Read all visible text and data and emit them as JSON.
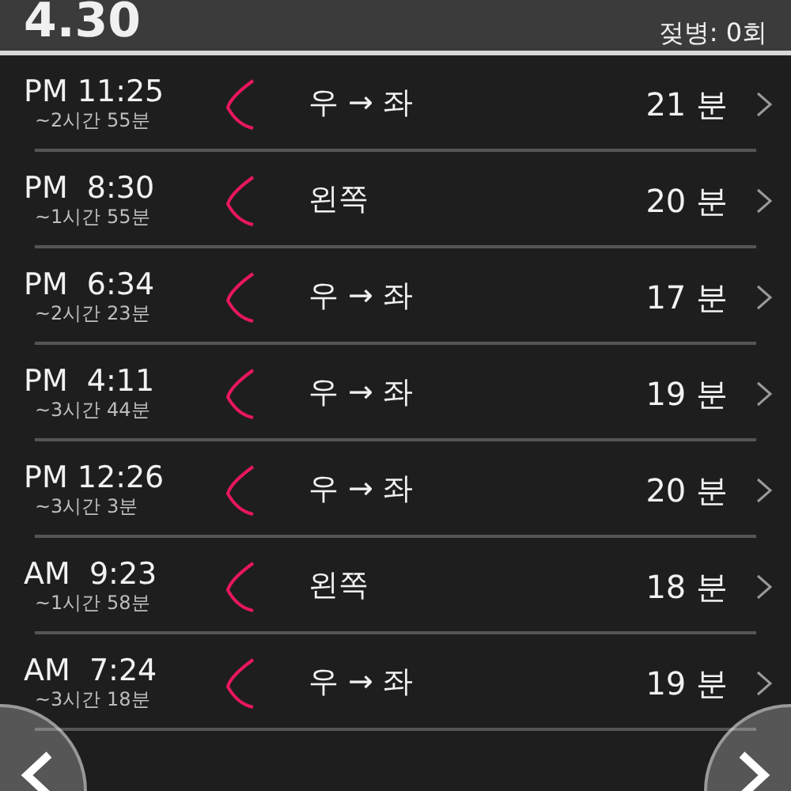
{
  "header": {
    "date": "4.30",
    "bottle_count": "젖병: 0회"
  },
  "sessions": [
    {
      "time": "PM 11:25",
      "interval": "~2시간 55분",
      "side": "우 → 좌",
      "duration": "21 분"
    },
    {
      "time": "PM  8:30",
      "interval": "~1시간 55분",
      "side": "왼쪽",
      "duration": "20 분"
    },
    {
      "time": "PM  6:34",
      "interval": "~2시간 23분",
      "side": "우 → 좌",
      "duration": "17 분"
    },
    {
      "time": "PM  4:11",
      "interval": "~3시간 44분",
      "side": "우 → 좌",
      "duration": "19 분"
    },
    {
      "time": "PM 12:26",
      "interval": "~3시간 3분",
      "side": "우 → 좌",
      "duration": "20 분"
    },
    {
      "time": "AM  9:23",
      "interval": "~1시간 58분",
      "side": "왼쪽",
      "duration": "18 분"
    },
    {
      "time": "AM  7:24",
      "interval": "~3시간 18분",
      "side": "우 → 좌",
      "duration": "19 분"
    }
  ]
}
